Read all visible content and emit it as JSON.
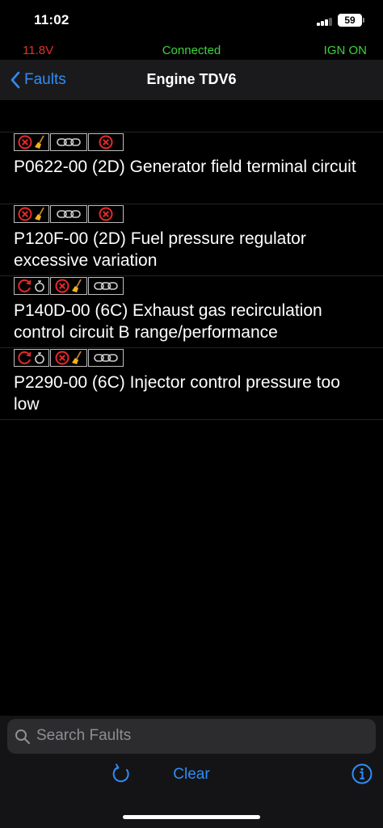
{
  "status_bar": {
    "time": "11:02",
    "battery": "59"
  },
  "connection": {
    "voltage": "11.8V",
    "status": "Connected",
    "ignition": "IGN ON"
  },
  "nav": {
    "back_label": "Faults",
    "title": "Engine TDV6"
  },
  "faults": [
    {
      "code_text": "P0622-00 (2D) Generator field terminal circuit",
      "icons": [
        [
          "fault-cross-icon",
          "broom-icon"
        ],
        [
          "chain-link-icon"
        ],
        [
          "fault-cross-icon"
        ]
      ]
    },
    {
      "code_text": "P120F-00 (2D) Fuel pressure regulator excessive variation",
      "icons": [
        [
          "fault-cross-icon",
          "broom-icon"
        ],
        [
          "chain-link-icon"
        ],
        [
          "fault-cross-icon"
        ]
      ]
    },
    {
      "code_text": "P140D-00 (6C) Exhaust gas recirculation control circuit B range/performance",
      "icons": [
        [
          "cycle-arrow-icon",
          "stopwatch-icon"
        ],
        [
          "fault-cross-icon",
          "broom-icon"
        ],
        [
          "chain-link-icon"
        ]
      ]
    },
    {
      "code_text": "P2290-00 (6C) Injector control pressure too low",
      "icons": [
        [
          "cycle-arrow-icon",
          "stopwatch-icon"
        ],
        [
          "fault-cross-icon",
          "broom-icon"
        ],
        [
          "chain-link-icon"
        ]
      ]
    }
  ],
  "search": {
    "placeholder": "Search Faults",
    "value": ""
  },
  "toolbar": {
    "clear_label": "Clear",
    "refresh_icon": "refresh-icon",
    "info_icon": "info-icon"
  },
  "colors": {
    "accent": "#2f8cf6",
    "connected": "#3dd13d",
    "voltage": "#e0312b",
    "fault_red": "#e8292a",
    "broom": "#f2b11c"
  }
}
